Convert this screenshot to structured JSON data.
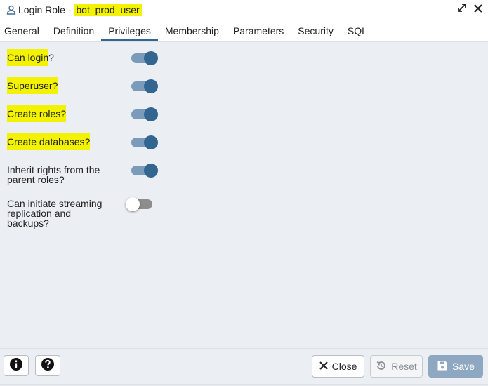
{
  "window": {
    "title_prefix": "Login Role - ",
    "role_name": "bot_prod_user",
    "expand_icon": "expand-icon",
    "close_icon": "close-icon"
  },
  "tabs": [
    {
      "label": "General",
      "active": false
    },
    {
      "label": "Definition",
      "active": false
    },
    {
      "label": "Privileges",
      "active": true
    },
    {
      "label": "Membership",
      "active": false
    },
    {
      "label": "Parameters",
      "active": false
    },
    {
      "label": "Security",
      "active": false
    },
    {
      "label": "SQL",
      "active": false
    }
  ],
  "privileges": [
    {
      "label": "Can login?",
      "highlight": "Can login",
      "enabled": true
    },
    {
      "label": "Superuser?",
      "highlight": "Superuser?",
      "enabled": true
    },
    {
      "label": "Create roles?",
      "highlight": "Create roles?",
      "enabled": true
    },
    {
      "label": "Create databases?",
      "highlight": "Create databases?",
      "enabled": true
    },
    {
      "label": "Inherit rights from the parent roles?",
      "highlight": "",
      "enabled": true
    },
    {
      "label": "Can initiate streaming replication and backups?",
      "highlight": "",
      "enabled": false
    }
  ],
  "footer": {
    "info_icon": "info-icon",
    "help_icon": "help-icon",
    "close_label": "Close",
    "reset_label": "Reset",
    "save_label": "Save"
  },
  "colors": {
    "accent": "#326690",
    "highlight": "#f3f200",
    "panel": "#ebeef3",
    "toggle_track_on": "#7b9bbb",
    "save_disabled": "#8fa8c1"
  }
}
